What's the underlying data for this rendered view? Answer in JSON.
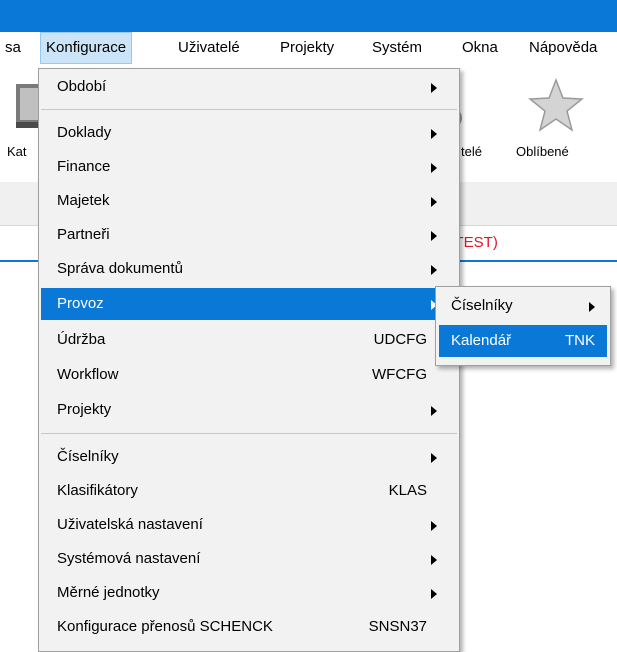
{
  "colors": {
    "accent": "#0a78d7",
    "highlight": "#0a78d7",
    "status_text": "#e81123"
  },
  "menubar": {
    "items": [
      {
        "label": "sa"
      },
      {
        "label": "Konfigurace",
        "active": true
      },
      {
        "label": "Uživatelé"
      },
      {
        "label": "Projekty"
      },
      {
        "label": "Systém"
      },
      {
        "label": "Okna"
      },
      {
        "label": "Nápověda"
      }
    ]
  },
  "toolbar": {
    "left_label": "Kat",
    "users_label": "telé",
    "favorites_label": "Oblíbené",
    "icons": [
      "book-icon",
      "gear-user-icon",
      "star-icon"
    ]
  },
  "status": {
    "text": "ra (TEST)"
  },
  "menu": {
    "items": [
      {
        "label": "Období",
        "submenu": true
      },
      {
        "label": "Doklady",
        "submenu": true
      },
      {
        "label": "Finance",
        "submenu": true
      },
      {
        "label": "Majetek",
        "submenu": true
      },
      {
        "label": "Partneři",
        "submenu": true
      },
      {
        "label": "Správa dokumentů",
        "submenu": true
      },
      {
        "label": "Provoz",
        "submenu": true,
        "highlighted": true
      },
      {
        "label": "Údržba",
        "shortcut": "UDCFG"
      },
      {
        "label": "Workflow",
        "shortcut": "WFCFG"
      },
      {
        "label": "Projekty",
        "submenu": true
      },
      {
        "label": "Číselníky",
        "submenu": true
      },
      {
        "label": "Klasifikátory",
        "shortcut": "KLAS"
      },
      {
        "label": "Uživatelská nastavení",
        "submenu": true
      },
      {
        "label": "Systémová nastavení",
        "submenu": true
      },
      {
        "label": "Měrné jednotky",
        "submenu": true
      },
      {
        "label": "Konfigurace přenosů SCHENCK",
        "shortcut": "SNSN37"
      }
    ]
  },
  "submenu": {
    "items": [
      {
        "label": "Číselníky",
        "submenu": true
      },
      {
        "label": "Kalendář",
        "shortcut": "TNK",
        "highlighted": true
      }
    ]
  }
}
